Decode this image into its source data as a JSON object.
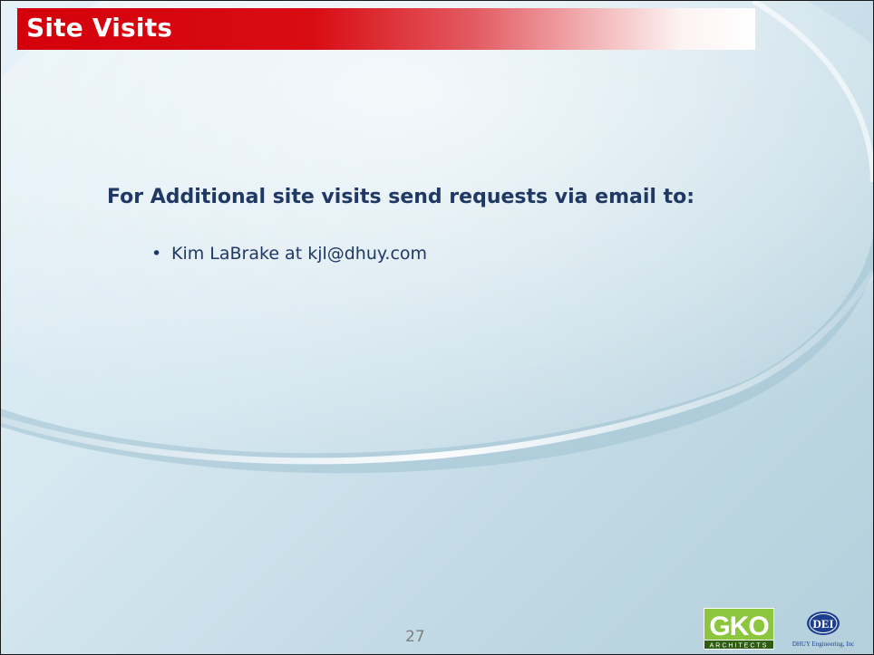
{
  "slide": {
    "title": "Site Visits",
    "heading": "For Additional site visits send requests via email to:",
    "bullets": [
      {
        "text": "Kim LaBrake at kjl@dhuy.com"
      }
    ],
    "page_number": "27"
  },
  "footer": {
    "logos": [
      {
        "name": "GKO Architects",
        "text": "GKO",
        "subtext": "ARCHITECTS",
        "color": "#8cc63f"
      },
      {
        "name": "DHUY Engineering, Inc.",
        "text": "DEI",
        "subtext": "DHUY Engineering, Inc",
        "color": "#1c3f8f"
      }
    ]
  },
  "colors": {
    "title_bar": "#d4000b",
    "heading": "#1f3864",
    "background": "#d3e6ef"
  }
}
